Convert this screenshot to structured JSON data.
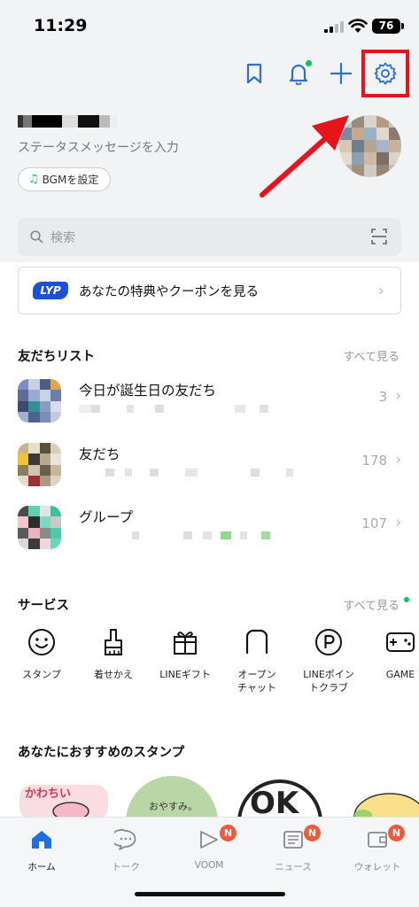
{
  "status_bar": {
    "time": "11:29",
    "battery": "76"
  },
  "profile": {
    "status_message": "ステータスメッセージを入力",
    "bgm_button": "BGMを設定"
  },
  "search": {
    "placeholder": "検索"
  },
  "lyp_banner": {
    "logo": "LYP",
    "text": "あなたの特典やクーポンを見る"
  },
  "friends_section": {
    "title": "友だちリスト",
    "see_all": "すべて見る",
    "rows": [
      {
        "name": "今日が誕生日の友だち",
        "count": "3"
      },
      {
        "name": "友だち",
        "count": "178"
      },
      {
        "name": "グループ",
        "count": "107"
      }
    ]
  },
  "services_section": {
    "title": "サービス",
    "see_all": "すべて見る",
    "items": [
      {
        "label": "スタンプ",
        "icon": "smiley-icon"
      },
      {
        "label": "着せかえ",
        "icon": "brush-icon"
      },
      {
        "label": "LINEギフト",
        "icon": "gift-icon"
      },
      {
        "label": "オープン\nチャット",
        "icon": "open-chat-icon"
      },
      {
        "label": "LINEポイン\nトクラブ",
        "icon": "points-icon"
      },
      {
        "label": "GAME",
        "icon": "gamepad-icon"
      }
    ]
  },
  "stamps_section": {
    "title": "あなたにおすすめのスタンプ",
    "sticker_texts": [
      "おやすみ。",
      "OK"
    ]
  },
  "tabbar": {
    "tabs": [
      {
        "label": "ホーム",
        "badge": ""
      },
      {
        "label": "トーク",
        "badge": ""
      },
      {
        "label": "VOOM",
        "badge": "N"
      },
      {
        "label": "ニュース",
        "badge": "N"
      },
      {
        "label": "ウォレット",
        "badge": "N"
      }
    ]
  },
  "colors": {
    "accent_green": "#06c755",
    "highlight_red": "#e8141c",
    "icon_blue": "#2f6fd6",
    "badge": "#ef5a3c"
  }
}
